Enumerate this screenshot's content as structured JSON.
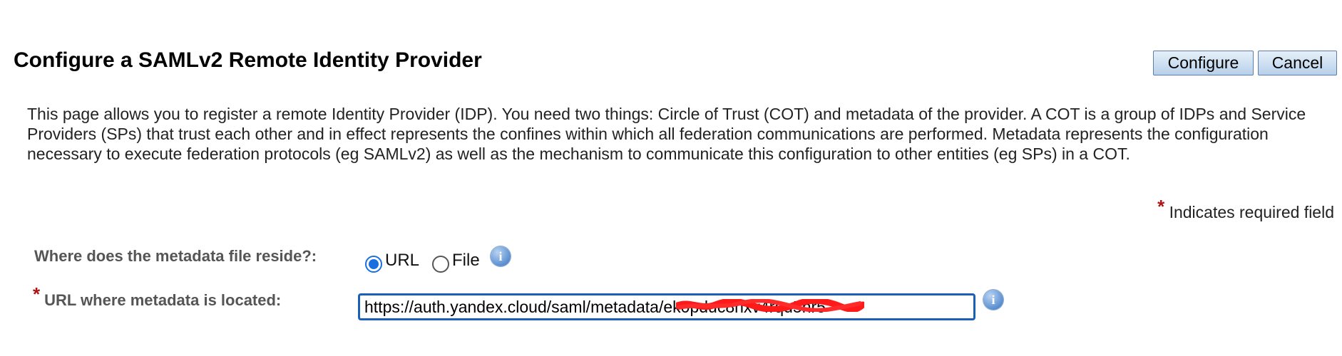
{
  "header": {
    "title": "Configure a SAMLv2 Remote Identity Provider",
    "configure_label": "Configure",
    "cancel_label": "Cancel"
  },
  "description": "This page allows you to register a remote Identity Provider (IDP). You need two things: Circle of Trust (COT) and metadata of the provider. A COT is a group of IDPs and Service Providers (SPs) that trust each other and in effect represents the confines within which all federation communications are performed. Metadata represents the configuration necessary to execute federation protocols (eg SAMLv2) as well as the mechanism to communicate this configuration to other entities (eg SPs) in a COT.",
  "required_note": {
    "star": "*",
    "text": "Indicates required field"
  },
  "form": {
    "reside_label": "Where does the metadata file reside?:",
    "reside_options": [
      {
        "label": "URL",
        "checked": true
      },
      {
        "label": "File",
        "checked": false
      }
    ],
    "url_label": "URL where metadata is located:",
    "url_value": "https://auth.yandex.cloud/saml/metadata/ek0pduc8hxv4rqu5nr5"
  },
  "icons": {
    "info": "info-icon",
    "info_glyph": "i"
  },
  "colors": {
    "button_border": "#5a7fa8",
    "input_focus": "#1c5fb8",
    "required": "#b01515",
    "redaction": "#ff1a1a"
  }
}
